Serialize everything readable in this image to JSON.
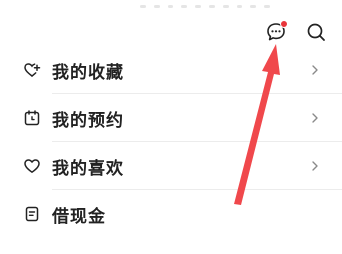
{
  "header": {
    "icons": [
      "message-icon",
      "search-icon"
    ],
    "has_unread_badge": true,
    "badge_color": "#e8343a"
  },
  "menu": {
    "items": [
      {
        "label": "我的收藏",
        "icon": "heart-plus-icon"
      },
      {
        "label": "我的预约",
        "icon": "calendar-clock-icon"
      },
      {
        "label": "我的喜欢",
        "icon": "heart-icon"
      },
      {
        "label": "借现金",
        "icon": "document-icon"
      }
    ]
  },
  "annotation": {
    "arrow_color": "#f0484c",
    "points_to": "message-icon"
  }
}
